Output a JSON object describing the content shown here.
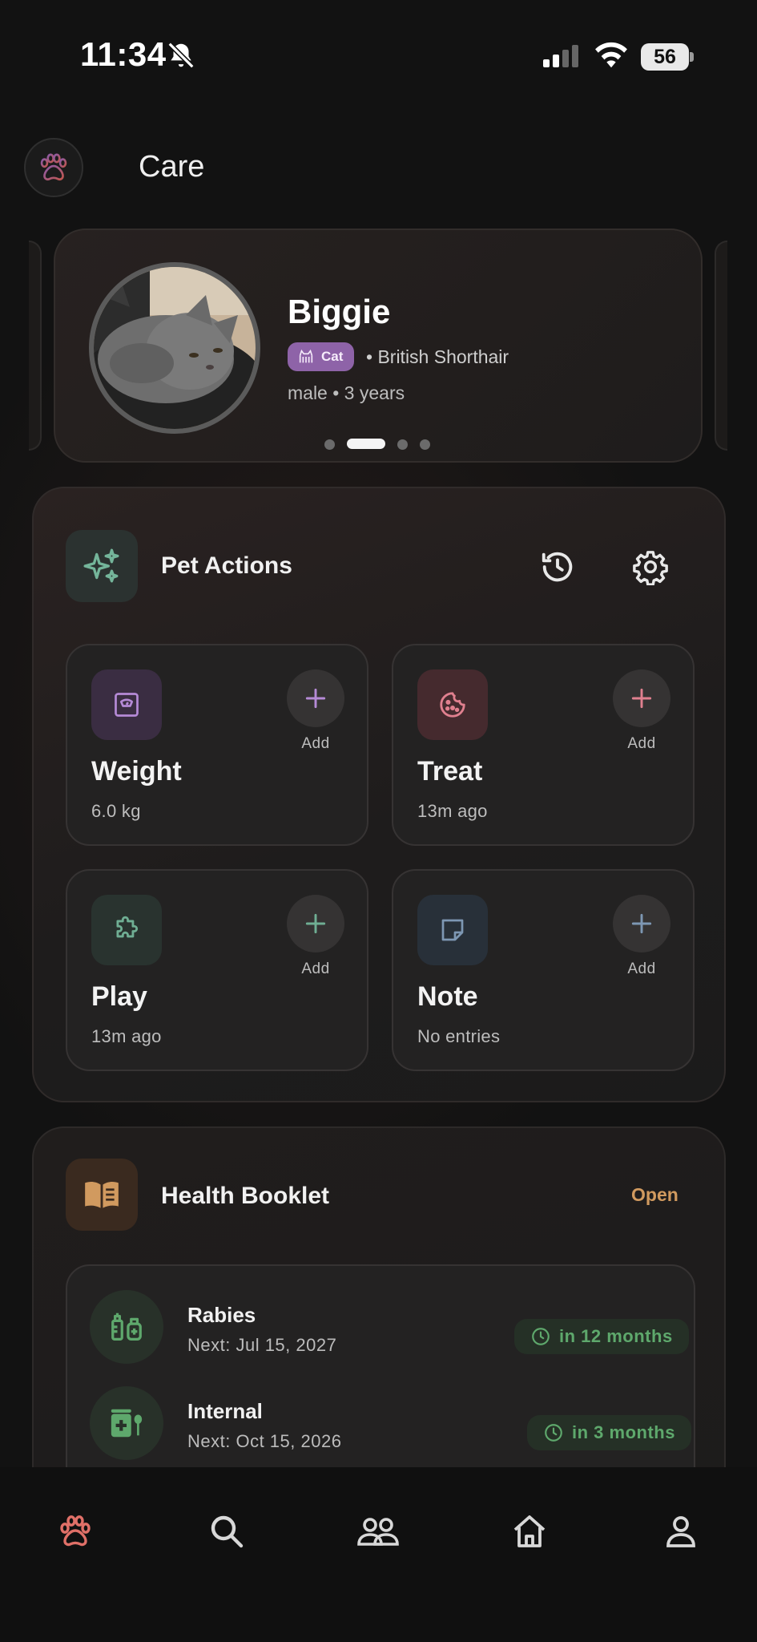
{
  "status_bar": {
    "time": "11:34",
    "battery": "56"
  },
  "header": {
    "title": "Care"
  },
  "pet": {
    "name": "Biggie",
    "species": "Cat",
    "breed": "• British Shorthair",
    "meta": "male • 3 years",
    "carousel": {
      "pages": 4,
      "active_index": 1
    }
  },
  "pet_actions": {
    "title": "Pet Actions",
    "tiles": [
      {
        "title": "Weight",
        "subtitle": "6.0 kg",
        "add_label": "Add",
        "icon": "scale-icon",
        "accent": "#b58ad6"
      },
      {
        "title": "Treat",
        "subtitle": "13m ago",
        "add_label": "Add",
        "icon": "cookie-icon",
        "accent": "#e0808f"
      },
      {
        "title": "Play",
        "subtitle": "13m ago",
        "add_label": "Add",
        "icon": "puzzle-icon",
        "accent": "#6fae93"
      },
      {
        "title": "Note",
        "subtitle": "No entries",
        "add_label": "Add",
        "icon": "note-icon",
        "accent": "#7d97b3"
      }
    ]
  },
  "health_booklet": {
    "title": "Health Booklet",
    "open_label": "Open",
    "vaccinations": [
      {
        "name": "Rabies",
        "next": "Next: Jul 15, 2027",
        "due": "in 12 months",
        "icon": "vaccine-icon"
      },
      {
        "name": "Internal",
        "next": "Next: Oct 15, 2026",
        "due": "in 3 months",
        "icon": "medicine-icon"
      }
    ]
  },
  "colors": {
    "background": "#121212",
    "species_badge": "#8e63a8",
    "open_link": "#d19a5f",
    "due_green": "#5ea86c",
    "active_nav": "#e07068"
  },
  "bottom_nav": [
    {
      "icon": "paw-icon",
      "active": true
    },
    {
      "icon": "search-icon",
      "active": false
    },
    {
      "icon": "people-icon",
      "active": false
    },
    {
      "icon": "home-icon",
      "active": false
    },
    {
      "icon": "profile-icon",
      "active": false
    }
  ]
}
